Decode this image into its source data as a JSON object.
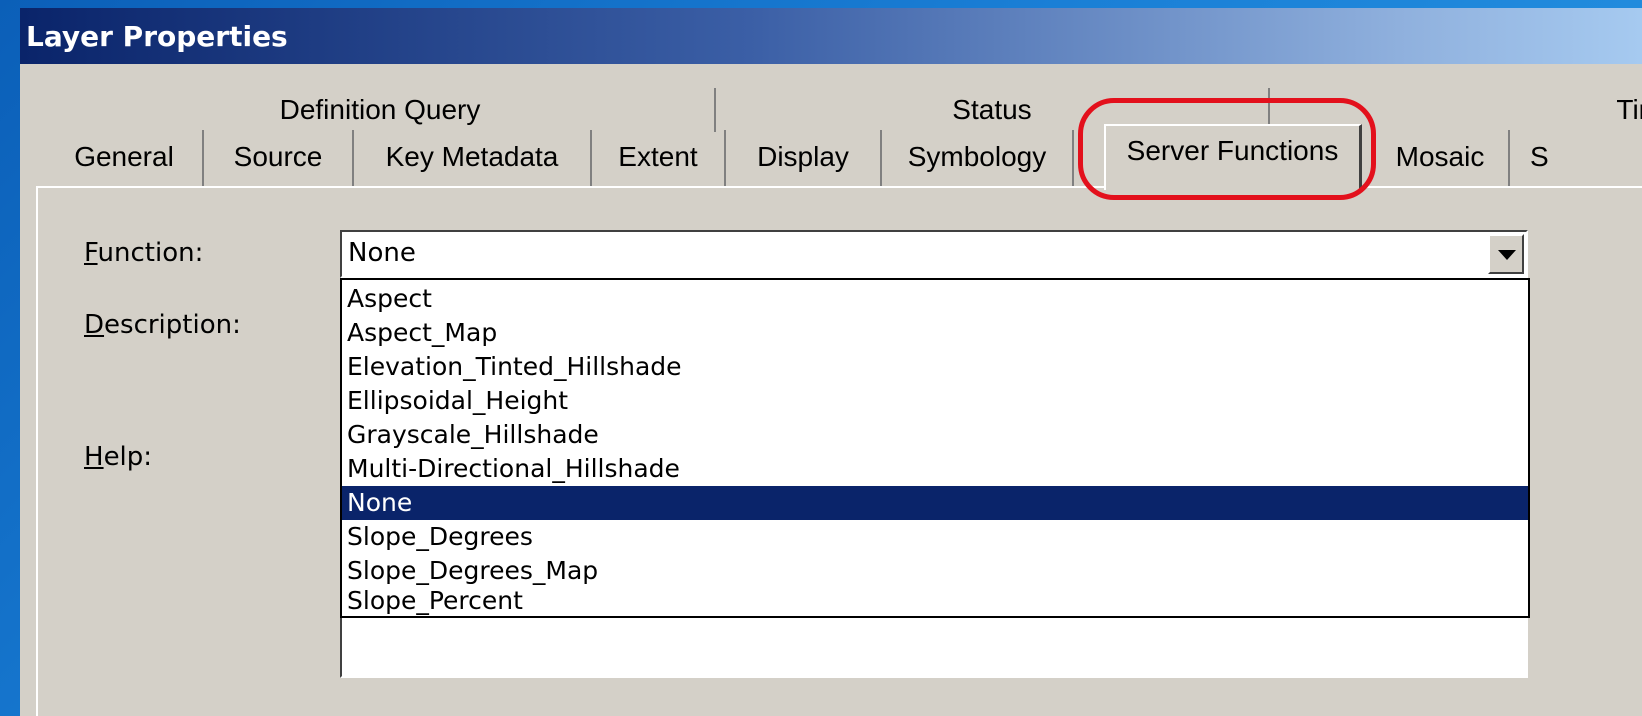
{
  "window": {
    "title": "Layer Properties"
  },
  "tabs_back": [
    "Definition Query",
    "Status",
    "Tim"
  ],
  "tabs_front": [
    "General",
    "Source",
    "Key Metadata",
    "Extent",
    "Display",
    "Symbology",
    "Server Functions",
    "Mosaic",
    "S"
  ],
  "active_tab": "Server Functions",
  "labels": {
    "function_prefix": "F",
    "function_rest": "unction:",
    "description_prefix": "D",
    "description_rest": "escription:",
    "help_prefix": "H",
    "help_rest": "elp:"
  },
  "function_combo": {
    "value": "None"
  },
  "function_options": [
    "Aspect",
    "Aspect_Map",
    "Elevation_Tinted_Hillshade",
    "Ellipsoidal_Height",
    "Grayscale_Hillshade",
    "Multi-Directional_Hillshade",
    "None",
    "Slope_Degrees",
    "Slope_Degrees_Map",
    "Slope_Percent"
  ],
  "selected_option": "None",
  "colors": {
    "selection": "#0a246a",
    "highlight_ring": "#e3101c",
    "dialog_face": "#d4d0c8"
  }
}
